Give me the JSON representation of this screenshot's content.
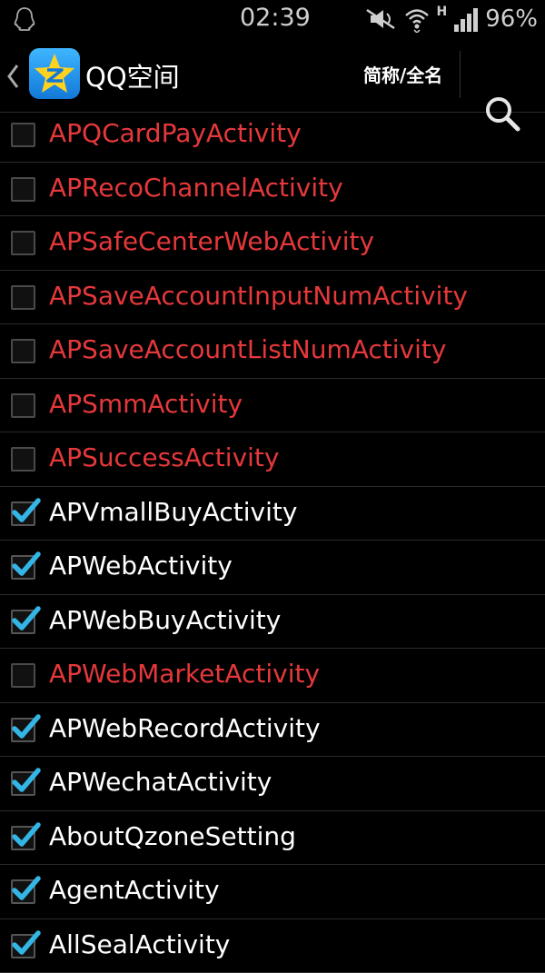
{
  "status_bar": {
    "time": "02:39",
    "network_type": "H",
    "battery": "96%"
  },
  "action_bar": {
    "app_name": "QQ空间",
    "name_toggle": "简称/全名"
  },
  "items": [
    {
      "label": "APQCardPayActivity",
      "checked": false
    },
    {
      "label": "APRecoChannelActivity",
      "checked": false
    },
    {
      "label": "APSafeCenterWebActivity",
      "checked": false
    },
    {
      "label": "APSaveAccountInputNumActivity",
      "checked": false
    },
    {
      "label": "APSaveAccountListNumActivity",
      "checked": false
    },
    {
      "label": "APSmmActivity",
      "checked": false
    },
    {
      "label": "APSuccessActivity",
      "checked": false
    },
    {
      "label": "APVmallBuyActivity",
      "checked": true
    },
    {
      "label": "APWebActivity",
      "checked": true
    },
    {
      "label": "APWebBuyActivity",
      "checked": true
    },
    {
      "label": "APWebMarketActivity",
      "checked": false
    },
    {
      "label": "APWebRecordActivity",
      "checked": true
    },
    {
      "label": "APWechatActivity",
      "checked": true
    },
    {
      "label": "AboutQzoneSetting",
      "checked": true
    },
    {
      "label": "AgentActivity",
      "checked": true
    },
    {
      "label": "AllSealActivity",
      "checked": true
    }
  ],
  "colors": {
    "enabled_text": "#ffffff",
    "disabled_text": "#e5383b",
    "check_mark": "#33b5e5"
  }
}
